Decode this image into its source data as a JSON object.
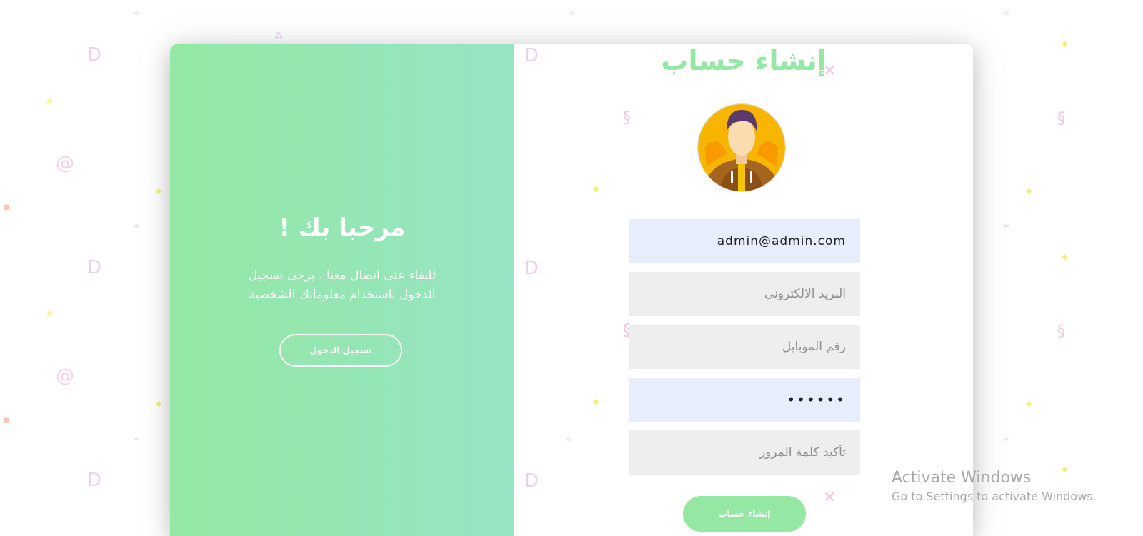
{
  "theme": {
    "accent": "#94e8a3",
    "gradient_end": "#96e4c4",
    "input_filled_bg": "#e8edfc",
    "input_empty_bg": "#eeeeee"
  },
  "welcome": {
    "title": "مرحبا بك !",
    "text_line1": "للبقاء على اتصال معنا ، يرجى تسجيل",
    "text_line2": "الدخول باستخدام معلوماتك الشخصية",
    "login_button": "تسجيل الدخول"
  },
  "form": {
    "title": "إنشاء حساب",
    "avatar_icon": "user-avatar-icon",
    "username": {
      "value": "admin@admin.com"
    },
    "email": {
      "value": "",
      "placeholder": "البريد الالكتروني"
    },
    "mobile": {
      "value": "",
      "placeholder": "رقم الموبايل"
    },
    "password": {
      "value": "••••••"
    },
    "confirm_password": {
      "value": "",
      "placeholder": "تأكيد كلمة المرور"
    },
    "submit_button": "إنشاء حساب"
  },
  "watermark": {
    "title": "Activate Windows",
    "subtitle": "Go to Settings to activate Windows."
  }
}
